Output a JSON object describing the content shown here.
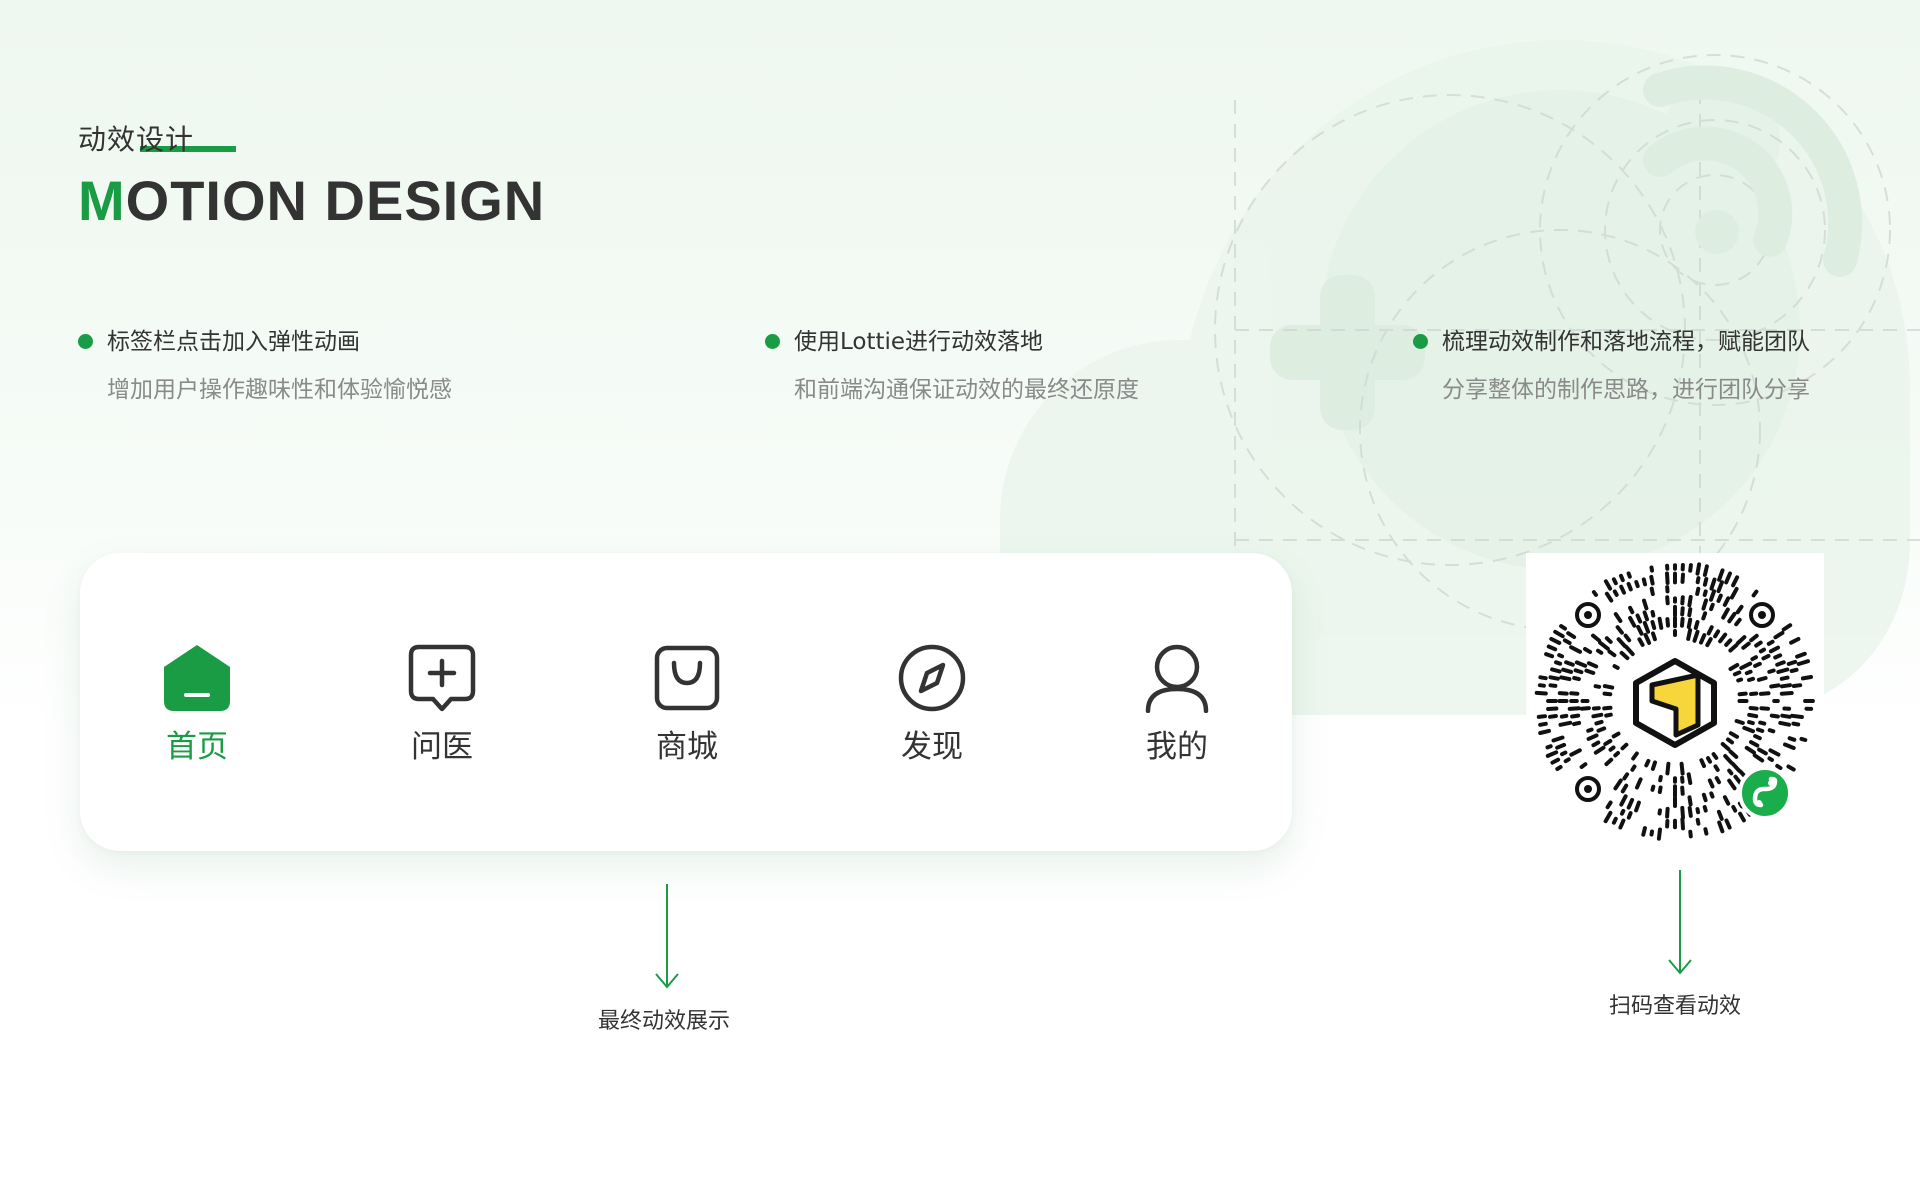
{
  "header": {
    "section_cn": "动效设计",
    "section_en_first": "M",
    "section_en_rest": "OTION DESIGN"
  },
  "features": [
    {
      "title": "标签栏点击加入弹性动画",
      "desc": "增加用户操作趣味性和体验愉悦感"
    },
    {
      "title": "使用Lottie进行动效落地",
      "desc": "和前端沟通保证动效的最终还原度"
    },
    {
      "title": "梳理动效制作和落地流程，赋能团队",
      "desc": "分享整体的制作思路，进行团队分享"
    }
  ],
  "tabbar": {
    "active_index": 0,
    "tabs": [
      {
        "label": "首页",
        "icon": "home-icon"
      },
      {
        "label": "问医",
        "icon": "chat-plus-icon"
      },
      {
        "label": "商城",
        "icon": "shopping-bag-icon"
      },
      {
        "label": "发现",
        "icon": "compass-icon"
      },
      {
        "label": "我的",
        "icon": "user-icon"
      }
    ]
  },
  "captions": {
    "final_demo": "最终动效展示",
    "scan_qr": "扫码查看动效"
  },
  "qr": {
    "icon": "mini-program-qr-code",
    "badge_icon": "mini-program-link-icon"
  },
  "colors": {
    "accent": "#1a9c44",
    "text": "#333333",
    "subtext": "#8a8a8a",
    "qr_logo_yellow": "#f6d63a"
  }
}
